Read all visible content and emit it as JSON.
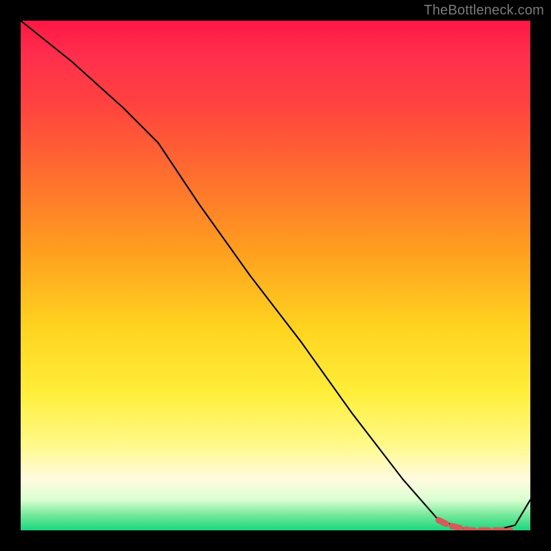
{
  "attribution": "TheBottleneck.com",
  "colors": {
    "background": "#000000",
    "attribution_text": "#7a7a7a",
    "curve": "#000000",
    "dashed_marker": "#d65a5a",
    "gradient_top": "#ff1744",
    "gradient_bottom": "#19d77e"
  },
  "chart_data": {
    "type": "line",
    "title": "",
    "xlabel": "",
    "ylabel": "",
    "xlim": [
      0,
      100
    ],
    "ylim": [
      0,
      100
    ],
    "grid": false,
    "legend": false,
    "annotations": [],
    "series": [
      {
        "name": "bottleneck-curve",
        "x": [
          0,
          10,
          20,
          27,
          35,
          45,
          55,
          65,
          75,
          82,
          88,
          93,
          97,
          100
        ],
        "values": [
          100,
          92,
          83,
          76,
          64,
          50,
          37,
          23,
          10,
          2,
          0,
          0,
          1,
          6
        ]
      },
      {
        "name": "optimal-range-marker",
        "x": [
          82,
          84,
          86,
          88,
          90,
          92,
          94,
          96
        ],
        "values": [
          2,
          1,
          0.5,
          0,
          0,
          0,
          0,
          0
        ]
      }
    ]
  }
}
